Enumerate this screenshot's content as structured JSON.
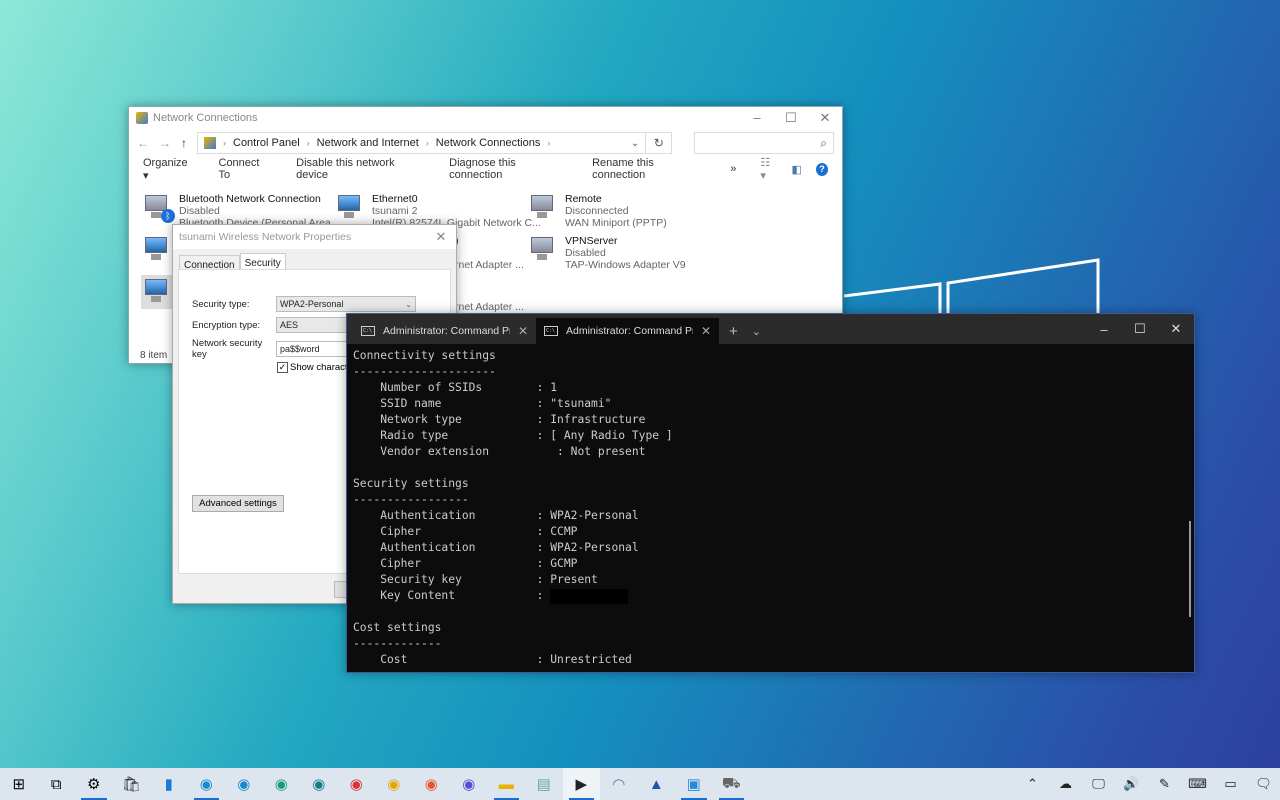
{
  "network_connections": {
    "title": "Network Connections",
    "breadcrumb": [
      "Control Panel",
      "Network and Internet",
      "Network Connections"
    ],
    "toolbar": [
      "Organize ▾",
      "Connect To",
      "Disable this network device",
      "Diagnose this connection",
      "Rename this connection",
      "»"
    ],
    "connections": [
      {
        "name": "Bluetooth Network Connection",
        "status": "Disabled",
        "device": "Bluetooth Device (Personal Area ..."
      },
      {
        "name": "Ethernet0",
        "status": "tsunami 2",
        "device": "Intel(R) 82574L Gigabit Network C..."
      },
      {
        "name": "Remote",
        "status": "Disconnected",
        "device": "WAN Miniport (PPTP)"
      },
      {
        "name": ")",
        "status": "",
        "device": "rnet Adapter ..."
      },
      {
        "name": "VPNServer",
        "status": "Disabled",
        "device": "TAP-Windows Adapter V9"
      },
      {
        "name": "",
        "status": "",
        "device": "rnet Adapter ..."
      }
    ],
    "status_bar": "8 item"
  },
  "properties_dialog": {
    "title": "tsunami Wireless Network Properties",
    "tabs": [
      "Connection",
      "Security"
    ],
    "active_tab": "Security",
    "security_type_label": "Security type:",
    "security_type_value": "WPA2-Personal",
    "encryption_type_label": "Encryption type:",
    "encryption_type_value": "AES",
    "key_label": "Network security key",
    "key_value": "pa$$word",
    "show_characters_label": "Show characters",
    "show_characters_checked": true,
    "advanced_button": "Advanced settings"
  },
  "terminal": {
    "tabs": [
      {
        "title": "Administrator: Command Prompt",
        "active": false
      },
      {
        "title": "Administrator: Command Prompt",
        "active": true
      }
    ],
    "sections": [
      {
        "header": "Connectivity settings",
        "rule": "---------------------",
        "rows": [
          {
            "key": "Number of SSIDs",
            "value": ": 1"
          },
          {
            "key": "SSID name",
            "value": ": \"tsunami\""
          },
          {
            "key": "Network type",
            "value": ": Infrastructure"
          },
          {
            "key": "Radio type",
            "value": ": [ Any Radio Type ]"
          },
          {
            "key": "Vendor extension",
            "value": "   : Not present"
          }
        ]
      },
      {
        "header": "Security settings",
        "rule": "-----------------",
        "rows": [
          {
            "key": "Authentication",
            "value": ": WPA2-Personal"
          },
          {
            "key": "Cipher",
            "value": ": CCMP"
          },
          {
            "key": "Authentication",
            "value": ": WPA2-Personal"
          },
          {
            "key": "Cipher",
            "value": ": GCMP"
          },
          {
            "key": "Security key",
            "value": ": Present"
          },
          {
            "key": "Key Content",
            "value": ": ",
            "redacted": true
          }
        ]
      },
      {
        "header": "Cost settings",
        "rule": "-------------",
        "rows": [
          {
            "key": "Cost",
            "value": ": Unrestricted"
          }
        ]
      }
    ]
  },
  "taskbar": {
    "apps": [
      "start-icon",
      "task-view-icon",
      "settings-icon",
      "store-icon",
      "phone-icon",
      "edge-icon",
      "edge-beta-icon",
      "edge-dev-icon",
      "edge-canary-icon",
      "chrome-icon",
      "chrome-canary-icon",
      "firefox-icon",
      "firefox-nightly-icon",
      "file-explorer-icon",
      "notepad-icon",
      "terminal-icon",
      "remote-desktop-icon",
      "photos-icon",
      "control-panel-icon",
      "network-icon"
    ],
    "tray": [
      "chevron-up-icon",
      "onedrive-icon",
      "network-tray-icon",
      "volume-icon",
      "pen-icon",
      "keyboard-icon",
      "tablet-icon",
      "notifications-icon"
    ]
  }
}
